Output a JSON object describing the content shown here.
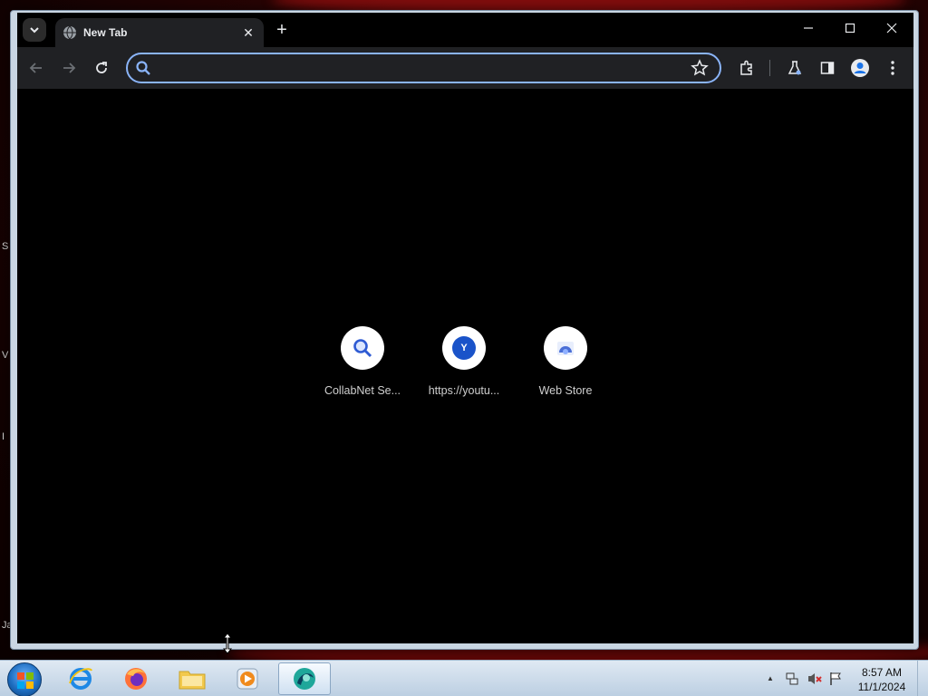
{
  "browser": {
    "tab": {
      "title": "New Tab"
    },
    "new_tab_symbol": "+",
    "tab_close_symbol": "✕",
    "window_controls": {
      "minimize": "—",
      "maximize": "☐",
      "close": "✕"
    },
    "omnibox": {
      "value": "",
      "placeholder": ""
    }
  },
  "new_tab_page": {
    "shortcuts": [
      {
        "label": "CollabNet Se...",
        "icon": "search-icon"
      },
      {
        "label": "https://youtu...",
        "icon": "letter-avatar",
        "letter": "Y"
      },
      {
        "label": "Web Store",
        "icon": "web-store-icon"
      }
    ]
  },
  "desktop": {
    "edge_texts": [
      "S",
      "V",
      "I",
      "Ja"
    ]
  },
  "taskbar": {
    "clock_time": "8:57 AM",
    "clock_date": "11/1/2024",
    "tray_expand_symbol": "▲"
  },
  "colors": {
    "accent": "#8ab4f8",
    "tab_bg": "#202124",
    "page_bg": "#000000",
    "youtube_avatar": "#1a53c9"
  }
}
